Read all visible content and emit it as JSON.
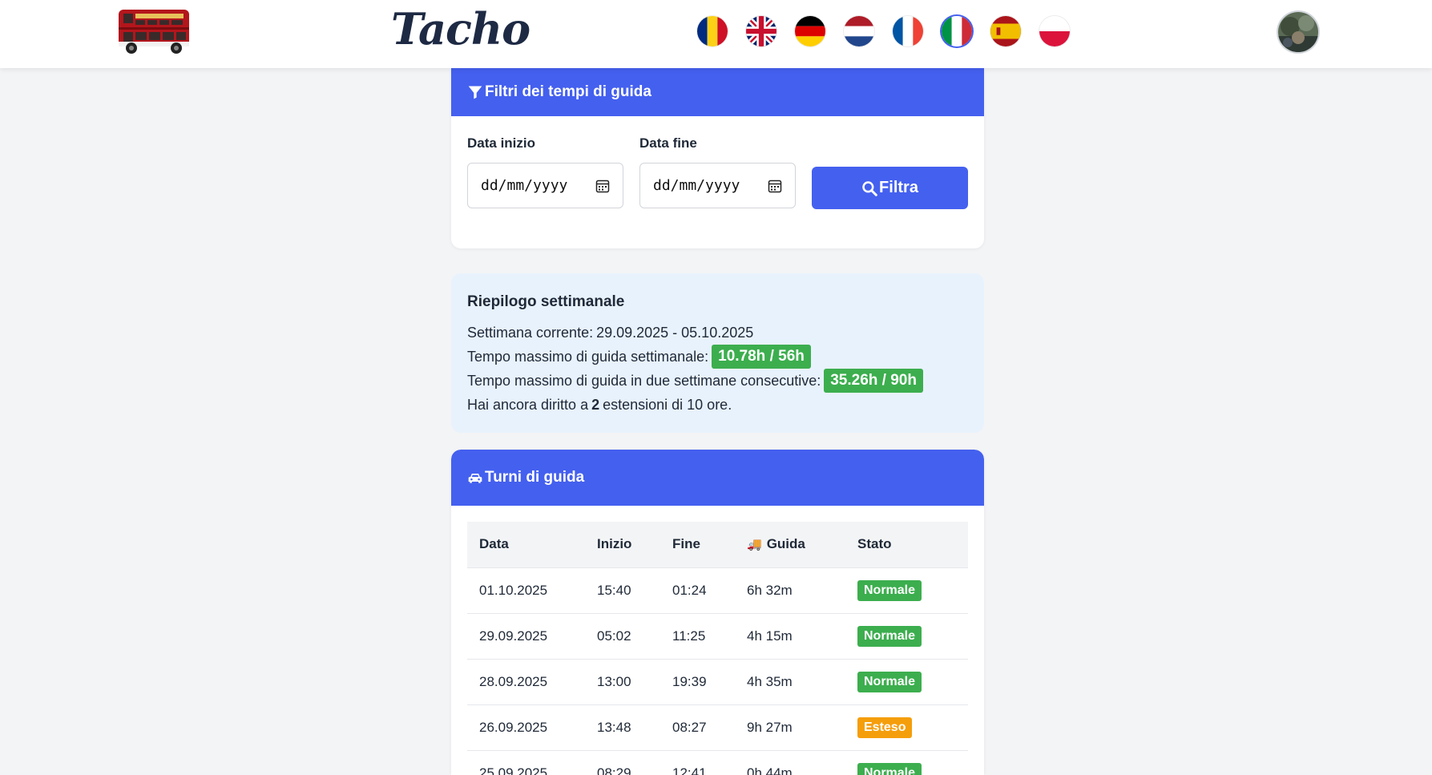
{
  "nav": {
    "brand": "Tacho",
    "flags": [
      "romania",
      "united-kingdom",
      "germany",
      "netherlands",
      "france",
      "italy",
      "spain",
      "poland"
    ],
    "active_flag": "italy"
  },
  "filters": {
    "title": "Filtri dei tempi di guida",
    "start_label": "Data inizio",
    "end_label": "Data fine",
    "start_placeholder": "dd/mm/yyyy",
    "end_placeholder": "dd/mm/yyyy",
    "button_label": "Filtra"
  },
  "summary": {
    "title": "Riepilogo settimanale",
    "current_week_label": "Settimana corrente:",
    "current_week_value": "29.09.2025 - 05.10.2025",
    "weekly_max_label": "Tempo massimo di guida settimanale:",
    "weekly_max_value": "10.78h / 56h",
    "two_weeks_label": "Tempo massimo di guida in due settimane consecutive:",
    "two_weeks_value": "35.26h / 90h",
    "extensions_prefix": "Hai ancora diritto a",
    "extensions_count": "2",
    "extensions_suffix": "estensioni di 10 ore."
  },
  "shifts": {
    "title": "Turni di guida",
    "columns": [
      "Data",
      "Inizio",
      "Fine",
      "Guida",
      "Stato"
    ],
    "rows": [
      {
        "date": "01.10.2025",
        "start": "15:40",
        "end": "01:24",
        "driving": "6h 32m",
        "status": "Normale"
      },
      {
        "date": "29.09.2025",
        "start": "05:02",
        "end": "11:25",
        "driving": "4h 15m",
        "status": "Normale"
      },
      {
        "date": "28.09.2025",
        "start": "13:00",
        "end": "19:39",
        "driving": "4h 35m",
        "status": "Normale"
      },
      {
        "date": "26.09.2025",
        "start": "13:48",
        "end": "08:27",
        "driving": "9h 27m",
        "status": "Esteso"
      },
      {
        "date": "25.09.2025",
        "start": "08:29",
        "end": "12:41",
        "driving": "0h 44m",
        "status": "Normale"
      }
    ]
  },
  "colors": {
    "primary": "#4460ef",
    "normal": "#3cae4e",
    "extended": "#f59e0b",
    "summary_bg": "#e8f2fd"
  }
}
